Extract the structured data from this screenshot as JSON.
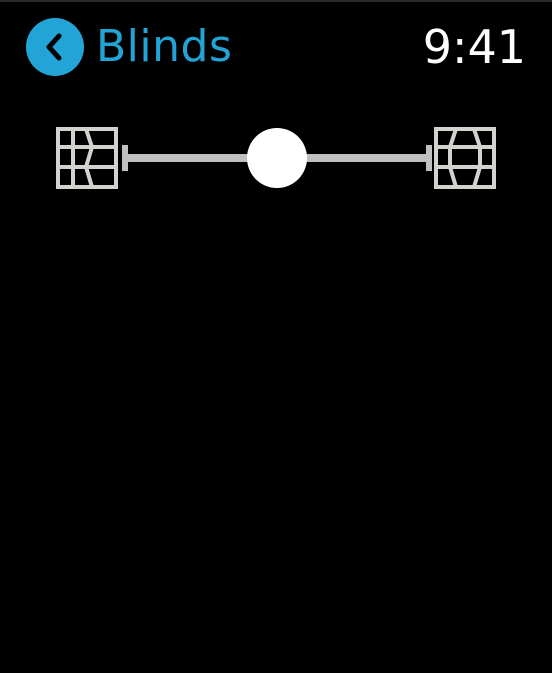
{
  "header": {
    "back_icon": "chevron-left-icon",
    "title": "Blinds",
    "time": "9:41"
  },
  "blinds_control": {
    "closed_icon": "blinds-closed-icon",
    "open_icon": "blinds-open-icon",
    "position": 0.5
  },
  "colors": {
    "accent": "#22a4d6",
    "background": "#000000",
    "icon": "#d4d2ce",
    "track": "#c0c0c0",
    "thumb": "#ffffff",
    "clock": "#ffffff"
  }
}
